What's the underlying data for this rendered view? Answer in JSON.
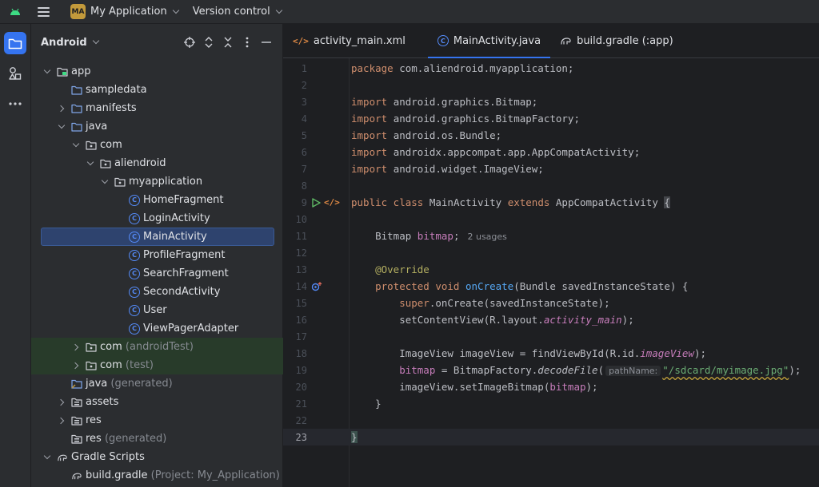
{
  "topbar": {
    "project_badge": "MA",
    "project_name": "My Application",
    "vcs_label": "Version control"
  },
  "project_panel": {
    "title": "Android",
    "tree": [
      {
        "label": "app",
        "suffix": "",
        "depth": 0,
        "expander": "open",
        "icon": "module-folder-icon"
      },
      {
        "label": "sampledata",
        "suffix": "",
        "depth": 1,
        "expander": "none",
        "icon": "folder-icon"
      },
      {
        "label": "manifests",
        "suffix": "",
        "depth": 1,
        "expander": "closed",
        "icon": "folder-icon"
      },
      {
        "label": "java",
        "suffix": "",
        "depth": 1,
        "expander": "open",
        "icon": "folder-icon"
      },
      {
        "label": "com",
        "suffix": "",
        "depth": 2,
        "expander": "open",
        "icon": "package-icon"
      },
      {
        "label": "aliendroid",
        "suffix": "",
        "depth": 3,
        "expander": "open",
        "icon": "package-icon"
      },
      {
        "label": "myapplication",
        "suffix": "",
        "depth": 4,
        "expander": "open",
        "icon": "package-icon"
      },
      {
        "label": "HomeFragment",
        "suffix": "",
        "depth": 5,
        "expander": "none",
        "icon": "class-icon"
      },
      {
        "label": "LoginActivity",
        "suffix": "",
        "depth": 5,
        "expander": "none",
        "icon": "class-icon"
      },
      {
        "label": "MainActivity",
        "suffix": "",
        "depth": 5,
        "expander": "none",
        "icon": "class-icon",
        "selected": true
      },
      {
        "label": "ProfileFragment",
        "suffix": "",
        "depth": 5,
        "expander": "none",
        "icon": "class-icon"
      },
      {
        "label": "SearchFragment",
        "suffix": "",
        "depth": 5,
        "expander": "none",
        "icon": "class-icon"
      },
      {
        "label": "SecondActivity",
        "suffix": "",
        "depth": 5,
        "expander": "none",
        "icon": "class-icon"
      },
      {
        "label": "User",
        "suffix": "",
        "depth": 5,
        "expander": "none",
        "icon": "class-icon"
      },
      {
        "label": "ViewPagerAdapter",
        "suffix": "",
        "depth": 5,
        "expander": "none",
        "icon": "class-icon"
      },
      {
        "label": "com",
        "suffix": " (androidTest)",
        "depth": 2,
        "expander": "closed",
        "icon": "package-icon",
        "green": true
      },
      {
        "label": "com",
        "suffix": " (test)",
        "depth": 2,
        "expander": "closed",
        "icon": "package-icon",
        "green": true
      },
      {
        "label": "java",
        "suffix": " (generated)",
        "depth": 1,
        "expander": "none",
        "icon": "generated-folder-icon"
      },
      {
        "label": "assets",
        "suffix": "",
        "depth": 1,
        "expander": "closed",
        "icon": "resource-folder-icon"
      },
      {
        "label": "res",
        "suffix": "",
        "depth": 1,
        "expander": "closed",
        "icon": "resource-folder-icon"
      },
      {
        "label": "res",
        "suffix": " (generated)",
        "depth": 1,
        "expander": "none",
        "icon": "resource-folder-icon"
      },
      {
        "label": "Gradle Scripts",
        "suffix": "",
        "depth": 0,
        "expander": "open",
        "icon": "gradle-icon"
      },
      {
        "label": "build.gradle",
        "suffix": " (Project: My_Application)",
        "depth": 1,
        "expander": "none",
        "icon": "gradle-icon"
      }
    ]
  },
  "tabs": [
    {
      "label": "activity_main.xml",
      "icon": "xml-icon",
      "active": false
    },
    {
      "label": "MainActivity.java",
      "icon": "class-icon",
      "active": true
    },
    {
      "label": "build.gradle (:app)",
      "icon": "gradle-icon",
      "active": false
    }
  ],
  "code": {
    "current_line": 23,
    "lines": [
      {
        "n": "1",
        "parts": [
          [
            "kw",
            "package "
          ],
          [
            "",
            "com.aliendroid.myapplication;"
          ]
        ]
      },
      {
        "n": "2",
        "parts": []
      },
      {
        "n": "3",
        "parts": [
          [
            "kw",
            "import "
          ],
          [
            "",
            "android.graphics.Bitmap;"
          ]
        ]
      },
      {
        "n": "4",
        "parts": [
          [
            "kw",
            "import "
          ],
          [
            "",
            "android.graphics.BitmapFactory;"
          ]
        ]
      },
      {
        "n": "5",
        "parts": [
          [
            "kw",
            "import "
          ],
          [
            "",
            "android.os.Bundle;"
          ]
        ]
      },
      {
        "n": "6",
        "parts": [
          [
            "kw",
            "import "
          ],
          [
            "",
            "androidx.appcompat.app.AppCompatActivity;"
          ]
        ]
      },
      {
        "n": "7",
        "parts": [
          [
            "kw",
            "import "
          ],
          [
            "",
            "android.widget.ImageView;"
          ]
        ]
      },
      {
        "n": "8",
        "parts": []
      },
      {
        "n": "9",
        "gutter": "run",
        "parts": [
          [
            "kw",
            "public class "
          ],
          [
            "",
            "MainActivity "
          ],
          [
            "kw",
            "extends "
          ],
          [
            "",
            "AppCompatActivity "
          ],
          [
            "caretbrace",
            "{"
          ]
        ]
      },
      {
        "n": "10",
        "parts": []
      },
      {
        "n": "11",
        "parts": [
          [
            "",
            "    Bitmap "
          ],
          [
            "fld",
            "bitmap"
          ],
          [
            "",
            ";"
          ],
          [
            "usages",
            "2 usages"
          ]
        ]
      },
      {
        "n": "12",
        "parts": []
      },
      {
        "n": "13",
        "parts": [
          [
            "ann",
            "    @Override"
          ]
        ]
      },
      {
        "n": "14",
        "gutter": "override",
        "parts": [
          [
            "kw",
            "    protected void "
          ],
          [
            "mth",
            "onCreate"
          ],
          [
            "",
            "(Bundle savedInstanceState) {"
          ]
        ]
      },
      {
        "n": "15",
        "parts": [
          [
            "kw",
            "        super"
          ],
          [
            "",
            ".onCreate(savedInstanceState);"
          ]
        ]
      },
      {
        "n": "16",
        "parts": [
          [
            "",
            "        setContentView(R.layout."
          ],
          [
            "fld ital",
            "activity_main"
          ],
          [
            "",
            ");"
          ]
        ]
      },
      {
        "n": "17",
        "parts": []
      },
      {
        "n": "18",
        "parts": [
          [
            "",
            "        ImageView imageView = findViewById(R.id."
          ],
          [
            "fld ital",
            "imageView"
          ],
          [
            "",
            ");"
          ]
        ]
      },
      {
        "n": "19",
        "parts": [
          [
            "fld",
            "        bitmap"
          ],
          [
            "",
            " = BitmapFactory."
          ],
          [
            "ital",
            "decodeFile"
          ],
          [
            "",
            "("
          ],
          [
            "hint",
            "pathName:"
          ],
          [
            "str squig",
            "\"/sdcard/myimage.jpg\""
          ],
          [
            "",
            ");"
          ]
        ]
      },
      {
        "n": "20",
        "parts": [
          [
            "",
            "        imageView.setImageBitmap("
          ],
          [
            "fld",
            "bitmap"
          ],
          [
            "",
            ");"
          ]
        ]
      },
      {
        "n": "21",
        "parts": [
          [
            "",
            "    }"
          ]
        ]
      },
      {
        "n": "22",
        "parts": []
      },
      {
        "n": "23",
        "parts": [
          [
            "bracehl",
            "}"
          ]
        ]
      }
    ]
  }
}
